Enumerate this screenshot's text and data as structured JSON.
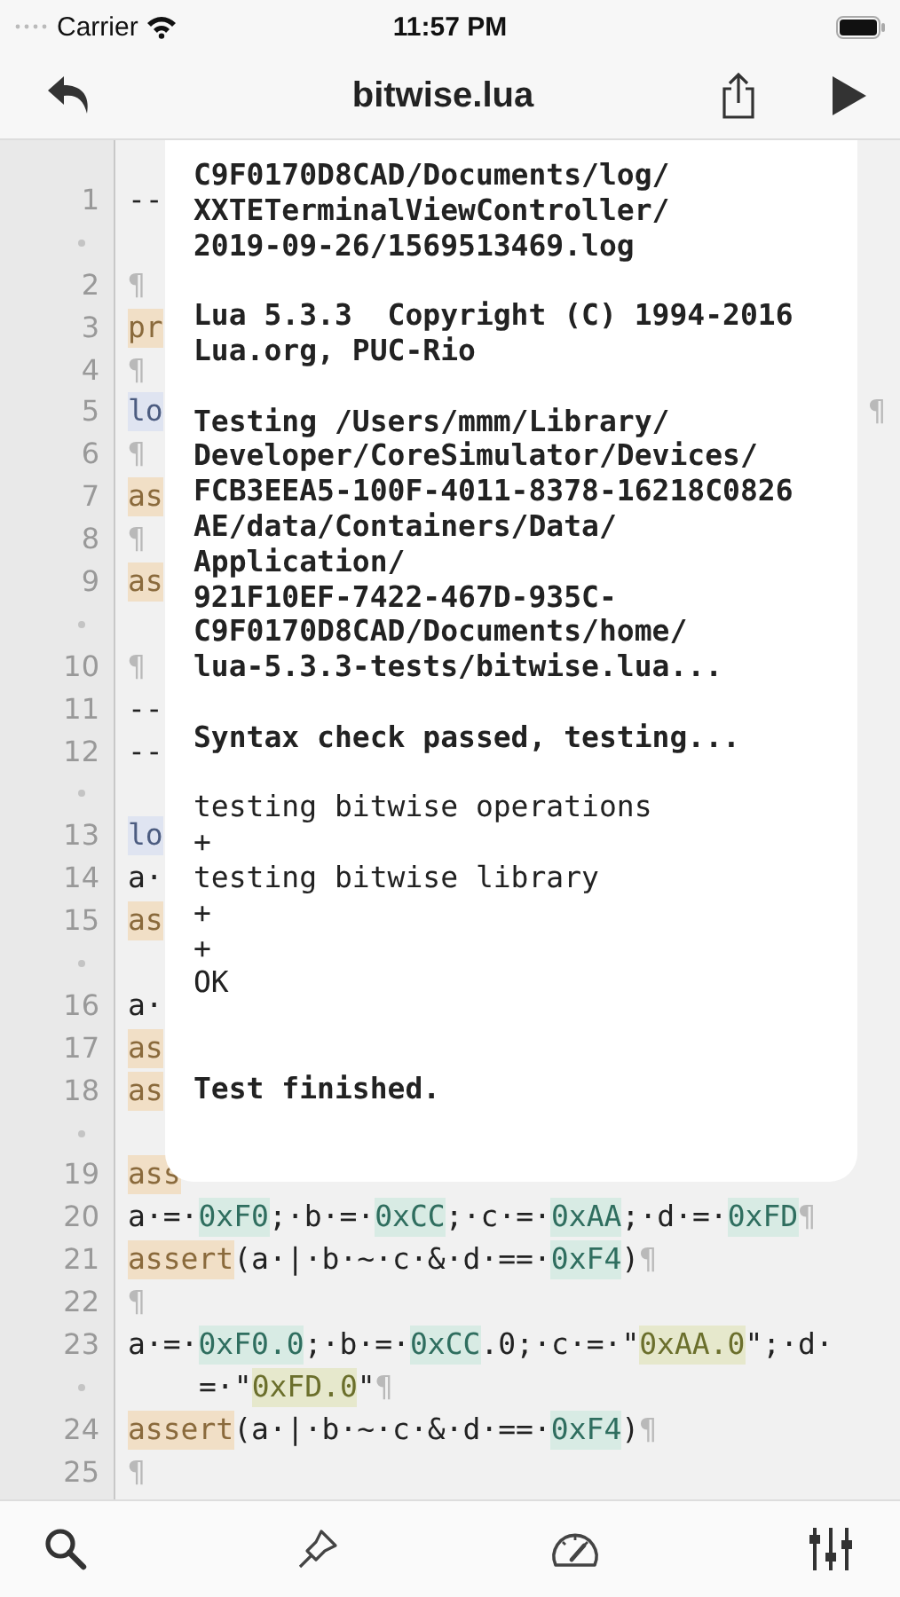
{
  "status_bar": {
    "carrier": "Carrier",
    "time": "11:57 PM"
  },
  "nav": {
    "title": "bitwise.lua"
  },
  "editor": {
    "rows": [
      {
        "number": "1",
        "wrapped": false,
        "tokens": [
          {
            "text": "--",
            "kind": "plain"
          }
        ]
      },
      {
        "wrapped": true,
        "tokens": []
      },
      {
        "number": "2",
        "wrapped": false,
        "tokens": [
          {
            "text": "¶",
            "kind": "mark"
          }
        ]
      },
      {
        "number": "3",
        "wrapped": false,
        "tokens": [
          {
            "text": "pr",
            "kind": "keyword"
          }
        ]
      },
      {
        "number": "4",
        "wrapped": false,
        "tokens": [
          {
            "text": "¶",
            "kind": "mark"
          }
        ]
      },
      {
        "number": "5",
        "wrapped": false,
        "tokens": [
          {
            "text": "lo",
            "kind": "local"
          }
        ],
        "tail": "¶"
      },
      {
        "number": "6",
        "wrapped": false,
        "tokens": [
          {
            "text": "¶",
            "kind": "mark"
          }
        ]
      },
      {
        "number": "7",
        "wrapped": false,
        "tokens": [
          {
            "text": "as",
            "kind": "keyword"
          }
        ]
      },
      {
        "number": "8",
        "wrapped": false,
        "tokens": [
          {
            "text": "¶",
            "kind": "mark"
          }
        ]
      },
      {
        "number": "9",
        "wrapped": false,
        "tokens": [
          {
            "text": "as",
            "kind": "keyword"
          }
        ]
      },
      {
        "wrapped": true,
        "tokens": []
      },
      {
        "number": "10",
        "wrapped": false,
        "tokens": [
          {
            "text": "¶",
            "kind": "mark"
          }
        ]
      },
      {
        "number": "11",
        "wrapped": false,
        "tokens": [
          {
            "text": "--",
            "kind": "plain"
          }
        ]
      },
      {
        "number": "12",
        "wrapped": false,
        "tokens": [
          {
            "text": "--",
            "kind": "plain"
          }
        ]
      },
      {
        "wrapped": true,
        "tokens": []
      },
      {
        "number": "13",
        "wrapped": false,
        "tokens": [
          {
            "text": "lo",
            "kind": "local"
          }
        ]
      },
      {
        "number": "14",
        "wrapped": false,
        "tokens": [
          {
            "text": "a·",
            "kind": "plain"
          }
        ]
      },
      {
        "number": "15",
        "wrapped": false,
        "tokens": [
          {
            "text": "as",
            "kind": "keyword"
          }
        ]
      },
      {
        "wrapped": true,
        "tokens": []
      },
      {
        "number": "16",
        "wrapped": false,
        "tokens": [
          {
            "text": "a·",
            "kind": "plain"
          }
        ]
      },
      {
        "number": "17",
        "wrapped": false,
        "tokens": [
          {
            "text": "as",
            "kind": "keyword"
          }
        ]
      },
      {
        "number": "18",
        "wrapped": false,
        "tokens": [
          {
            "text": "as",
            "kind": "keyword"
          }
        ]
      },
      {
        "wrapped": true,
        "tokens": []
      },
      {
        "number": "19",
        "wrapped": false,
        "tokens": [
          {
            "text": "ass",
            "kind": "keyword"
          }
        ]
      },
      {
        "number": "20",
        "wrapped": false,
        "tokens": [
          {
            "text": "a·=·",
            "kind": "plain"
          },
          {
            "text": "0xF0",
            "kind": "number"
          },
          {
            "text": ";·b·=·",
            "kind": "plain"
          },
          {
            "text": "0xCC",
            "kind": "number"
          },
          {
            "text": ";·c·=·",
            "kind": "plain"
          },
          {
            "text": "0xAA",
            "kind": "number"
          },
          {
            "text": ";·d·=·",
            "kind": "plain"
          },
          {
            "text": "0xFD",
            "kind": "number"
          },
          {
            "text": "¶",
            "kind": "mark"
          }
        ]
      },
      {
        "number": "21",
        "wrapped": false,
        "tokens": [
          {
            "text": "assert",
            "kind": "keyword"
          },
          {
            "text": "(a·|·b·~·c·&·d·==·",
            "kind": "plain"
          },
          {
            "text": "0xF4",
            "kind": "number"
          },
          {
            "text": ")",
            "kind": "plain"
          },
          {
            "text": "¶",
            "kind": "mark"
          }
        ]
      },
      {
        "number": "22",
        "wrapped": false,
        "tokens": [
          {
            "text": "¶",
            "kind": "mark"
          }
        ]
      },
      {
        "number": "23",
        "wrapped": false,
        "tokens": [
          {
            "text": "a·=·",
            "kind": "plain"
          },
          {
            "text": "0xF0.0",
            "kind": "number"
          },
          {
            "text": ";·b·=·",
            "kind": "plain"
          },
          {
            "text": "0xCC",
            "kind": "number"
          },
          {
            "text": ".0;·c·=·\"",
            "kind": "plain"
          },
          {
            "text": "0xAA.0",
            "kind": "string"
          },
          {
            "text": "\";·d·",
            "kind": "plain"
          }
        ]
      },
      {
        "wrapped": true,
        "tokens": [
          {
            "text": "=·\"",
            "kind": "plain"
          },
          {
            "text": "0xFD.0",
            "kind": "string"
          },
          {
            "text": "\"",
            "kind": "plain"
          },
          {
            "text": "¶",
            "kind": "mark"
          }
        ]
      },
      {
        "number": "24",
        "wrapped": false,
        "tokens": [
          {
            "text": "assert",
            "kind": "keyword"
          },
          {
            "text": "(a·|·b·~·c·&·d·==·",
            "kind": "plain"
          },
          {
            "text": "0xF4",
            "kind": "number"
          },
          {
            "text": ")",
            "kind": "plain"
          },
          {
            "text": "¶",
            "kind": "mark"
          }
        ]
      },
      {
        "number": "25",
        "wrapped": false,
        "tokens": [
          {
            "text": "¶",
            "kind": "mark"
          }
        ]
      }
    ]
  },
  "console": {
    "blocks": [
      {
        "kind": "status",
        "lines": [
          "C9F0170D8CAD/Documents/log/",
          "XXTETerminalViewController/",
          "2019-09-26/1569513469.log"
        ]
      },
      {
        "kind": "status",
        "lines": [
          "Lua 5.3.3  Copyright (C) 1994-2016",
          "Lua.org, PUC-Rio"
        ]
      },
      {
        "kind": "status",
        "lines": [
          "Testing /Users/mmm/Library/",
          "Developer/CoreSimulator/Devices/",
          "FCB3EEA5-100F-4011-8378-16218C0826",
          "AE/data/Containers/Data/",
          "Application/",
          "921F10EF-7422-467D-935C-",
          "C9F0170D8CAD/Documents/home/",
          "lua-5.3.3-tests/bitwise.lua..."
        ]
      },
      {
        "kind": "status",
        "lines": [
          "Syntax check passed, testing..."
        ]
      },
      {
        "kind": "output",
        "lines": [
          "testing bitwise operations",
          "+",
          "testing bitwise library",
          "+",
          "+",
          "OK"
        ]
      },
      {
        "kind": "status",
        "lines": [
          "Test finished."
        ]
      }
    ]
  }
}
